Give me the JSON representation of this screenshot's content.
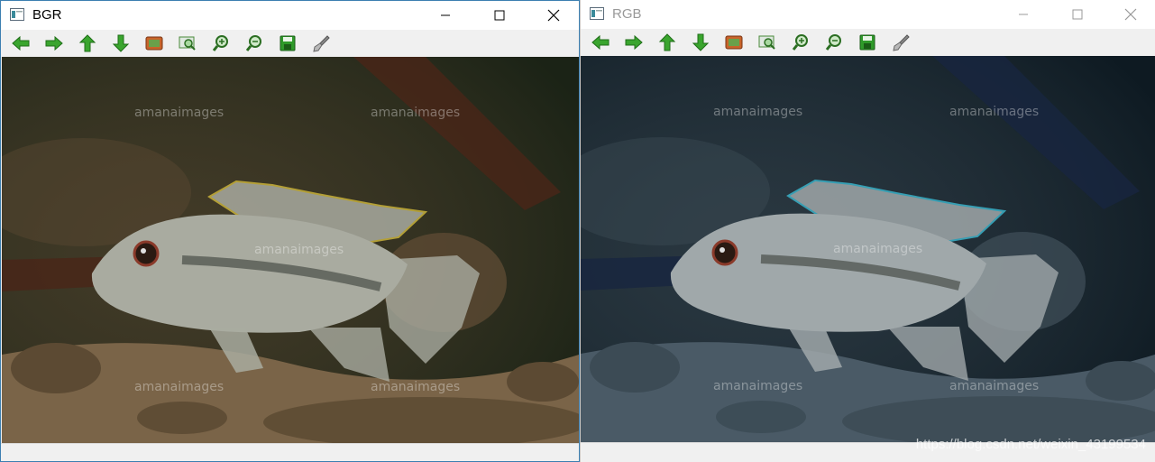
{
  "windows": [
    {
      "title": "BGR",
      "active": true,
      "controls": [
        "minimize-icon",
        "maximize-icon",
        "close-icon"
      ],
      "watermarks": [
        "amanaimages",
        "amanaimages",
        "amanaimages",
        "amanaimages",
        "amanaimages"
      ],
      "palette": {
        "bg": "#1b2316",
        "rock": "#5c4a33",
        "sand": "#7a6448",
        "fish_body": "#a9aba0",
        "fin_edge": "#c9b23a",
        "wood": "#4a2618"
      }
    },
    {
      "title": "RGB",
      "active": false,
      "controls": [
        "minimize-icon",
        "maximize-icon",
        "close-icon"
      ],
      "watermarks": [
        "amanaimages",
        "amanaimages",
        "amanaimages",
        "amanaimages",
        "amanaimages"
      ],
      "palette": {
        "bg": "#0e1a22",
        "rock": "#3c4b55",
        "sand": "#4a5a66",
        "fish_body": "#a0a8aa",
        "fin_edge": "#3ab2c9",
        "wood": "#182640"
      }
    }
  ],
  "toolbar": [
    {
      "name": "pan-left",
      "icon": "arrow-left-icon"
    },
    {
      "name": "pan-right",
      "icon": "arrow-right-icon"
    },
    {
      "name": "pan-up",
      "icon": "arrow-up-icon"
    },
    {
      "name": "pan-down",
      "icon": "arrow-down-icon"
    },
    {
      "name": "zoom-reset",
      "icon": "image-icon"
    },
    {
      "name": "zoom-fit",
      "icon": "zoom-fit-icon"
    },
    {
      "name": "zoom-in",
      "icon": "zoom-in-icon"
    },
    {
      "name": "zoom-out",
      "icon": "zoom-out-icon"
    },
    {
      "name": "save",
      "icon": "save-icon"
    },
    {
      "name": "properties",
      "icon": "brush-icon"
    }
  ],
  "footer_watermark": "https://blog.csdn.net/weixin_43199534"
}
